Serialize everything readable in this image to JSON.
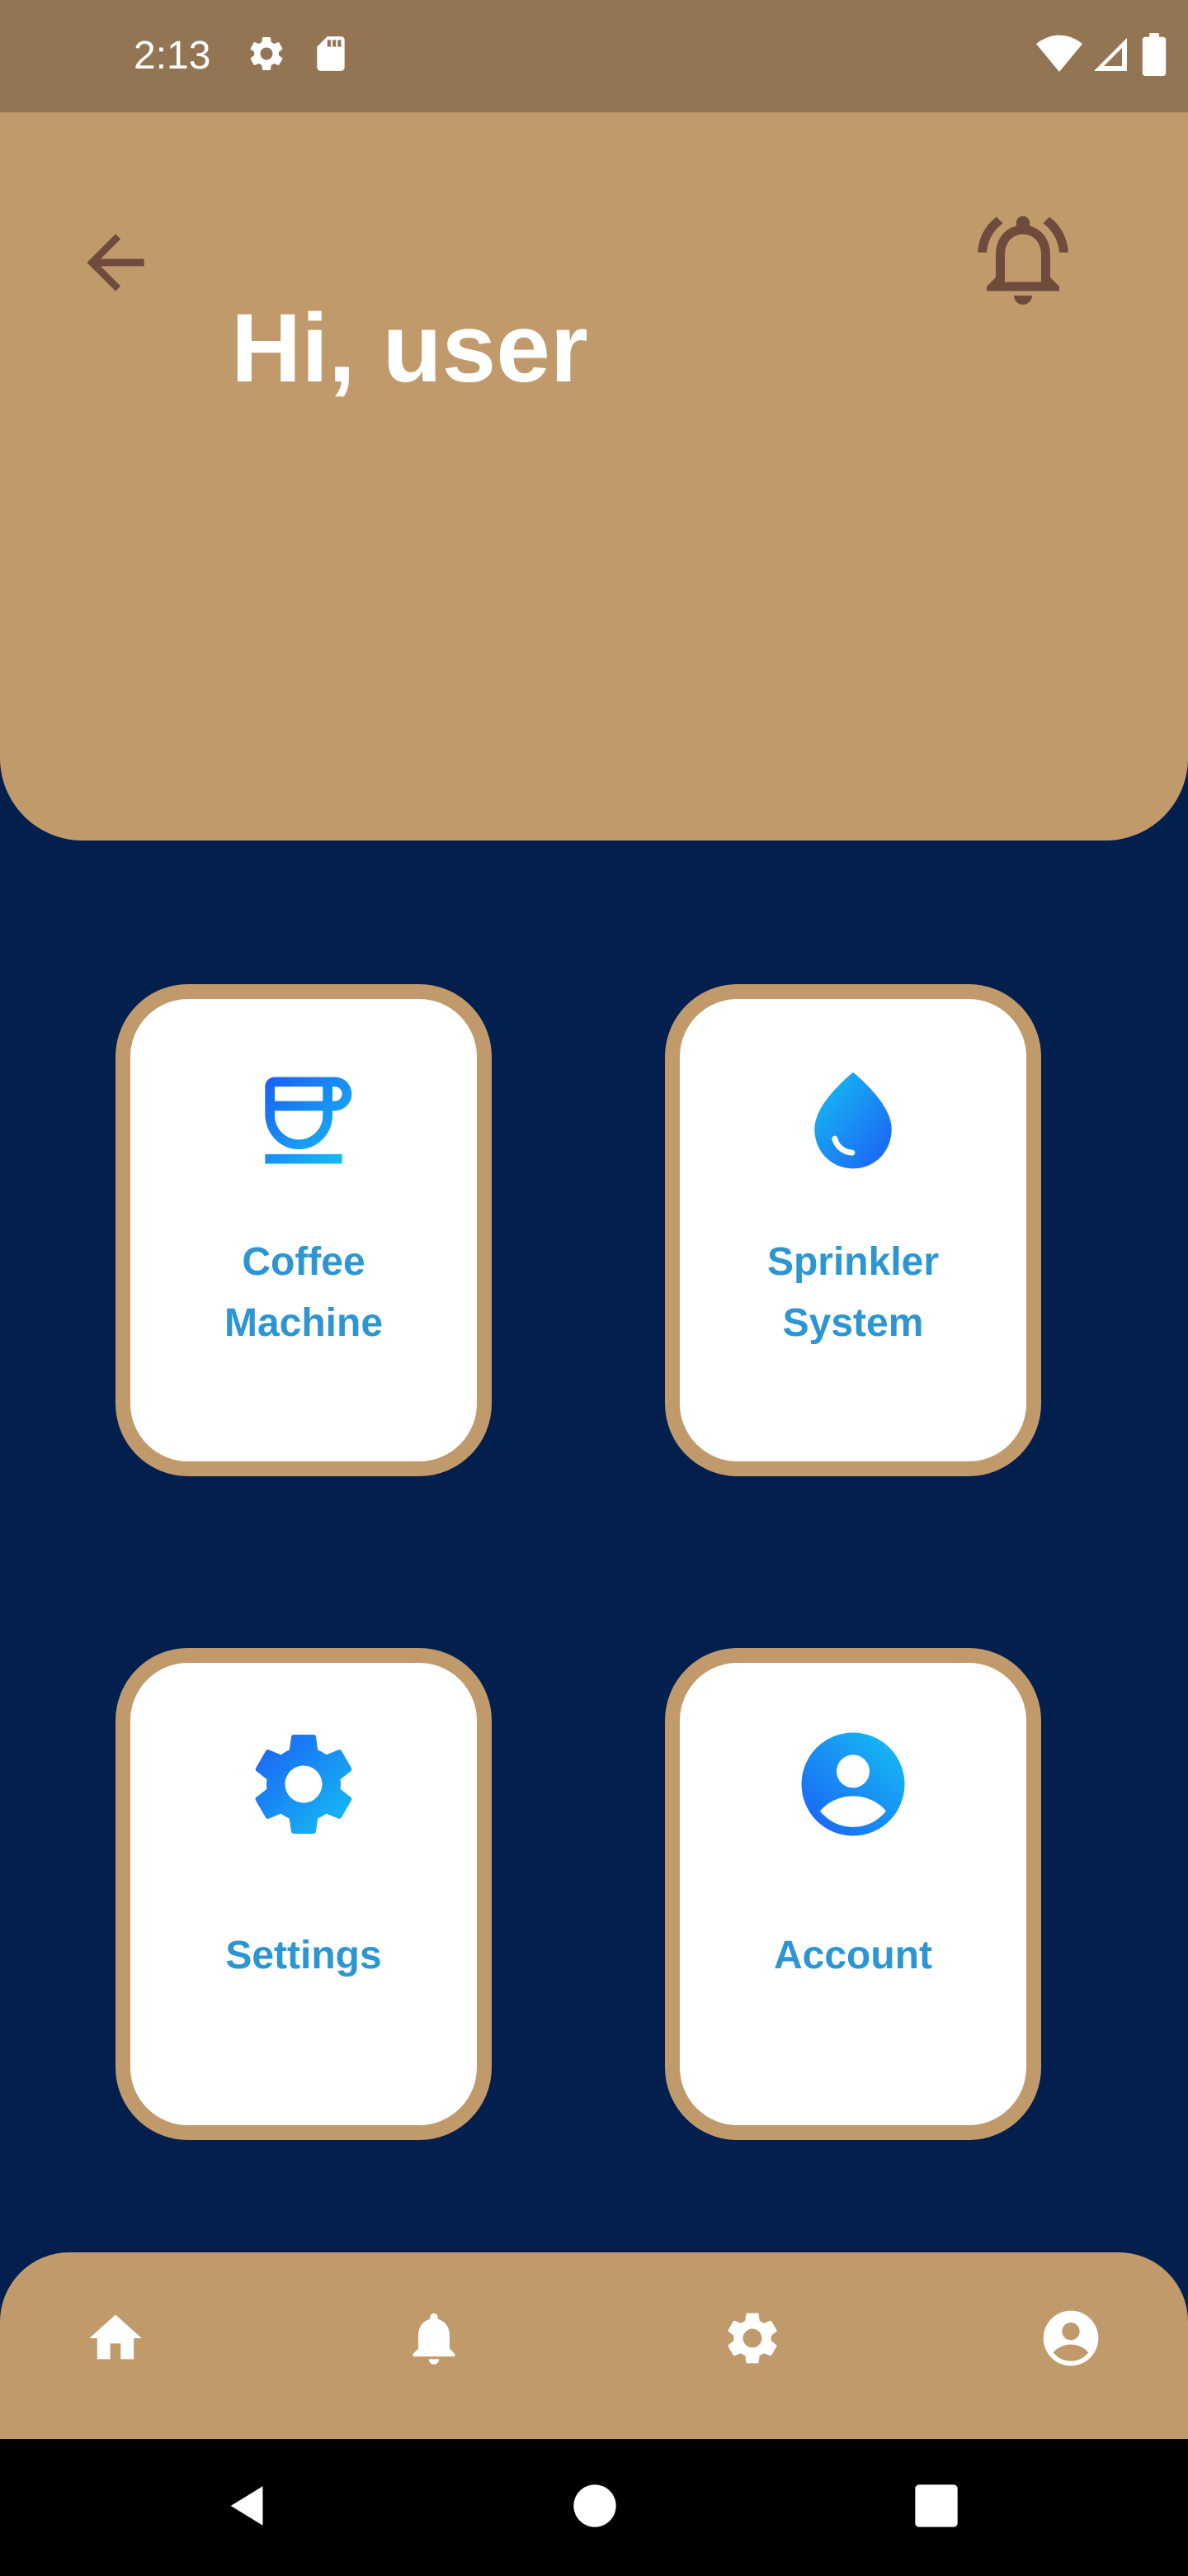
{
  "status_bar": {
    "time": "2:13",
    "icons": [
      "gear-icon",
      "sd-card-icon",
      "wifi-icon",
      "signal-icon",
      "battery-icon"
    ]
  },
  "header": {
    "greeting": "Hi, user",
    "back_icon": "arrow-left-icon",
    "alarm_icon": "bell-ring-icon"
  },
  "cards": [
    {
      "label": "Coffee\nMachine",
      "icon": "coffee-cup-icon"
    },
    {
      "label": "Sprinkler\nSystem",
      "icon": "water-drop-icon"
    },
    {
      "label": "Settings",
      "icon": "gear-icon"
    },
    {
      "label": "Account",
      "icon": "account-circle-icon"
    }
  ],
  "bottom_nav": {
    "items": [
      "home-icon",
      "bell-icon",
      "gear-icon",
      "account-circle-icon"
    ]
  },
  "system_nav": {
    "items": [
      "back-triangle-icon",
      "home-circle-icon",
      "recents-square-icon"
    ]
  },
  "colors": {
    "status_bar": "#937553",
    "header": "#c19a6b",
    "background": "#021f4d",
    "card_border": "#c19a6b",
    "card_label": "#2d96d2",
    "icon_gradient_start": "#1b5ef5",
    "icon_gradient_end": "#15c2f2",
    "header_icon": "#6f4b3e"
  }
}
